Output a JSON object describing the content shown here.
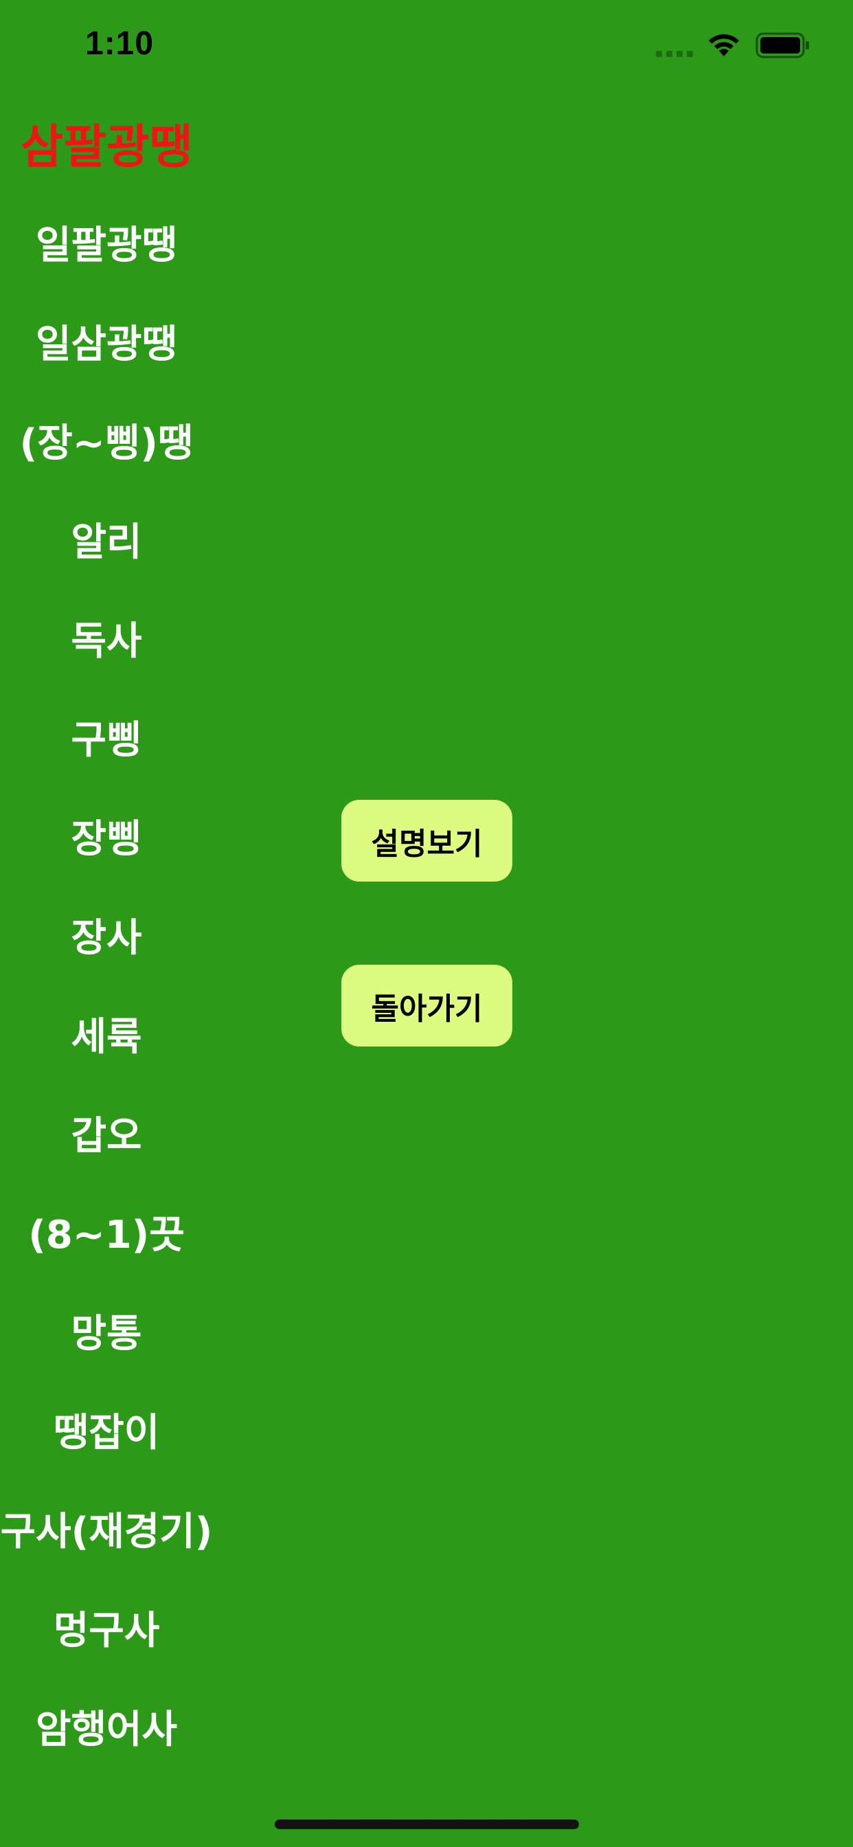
{
  "status_bar": {
    "time": "1:10",
    "signal_icon": "cellular-signal-icon",
    "wifi_icon": "wifi-icon",
    "battery_icon": "battery-icon"
  },
  "hands": {
    "title": "삼팔광땡",
    "items": [
      "일팔광땡",
      "일삼광땡",
      "(장~삥)땡",
      "알리",
      "독사",
      "구삥",
      "장삥",
      "장사",
      "세륙",
      "갑오",
      "(8~1)끗",
      "망통",
      "땡잡이",
      "구사(재경기)",
      "멍구사",
      "암행어사"
    ]
  },
  "buttons": {
    "show_description": "설명보기",
    "go_back": "돌아가기"
  },
  "colors": {
    "background": "#2c9a18",
    "title": "#ee1515",
    "item_text": "#ffffff",
    "button_bg": "#dcfb80",
    "button_text": "#000000"
  }
}
